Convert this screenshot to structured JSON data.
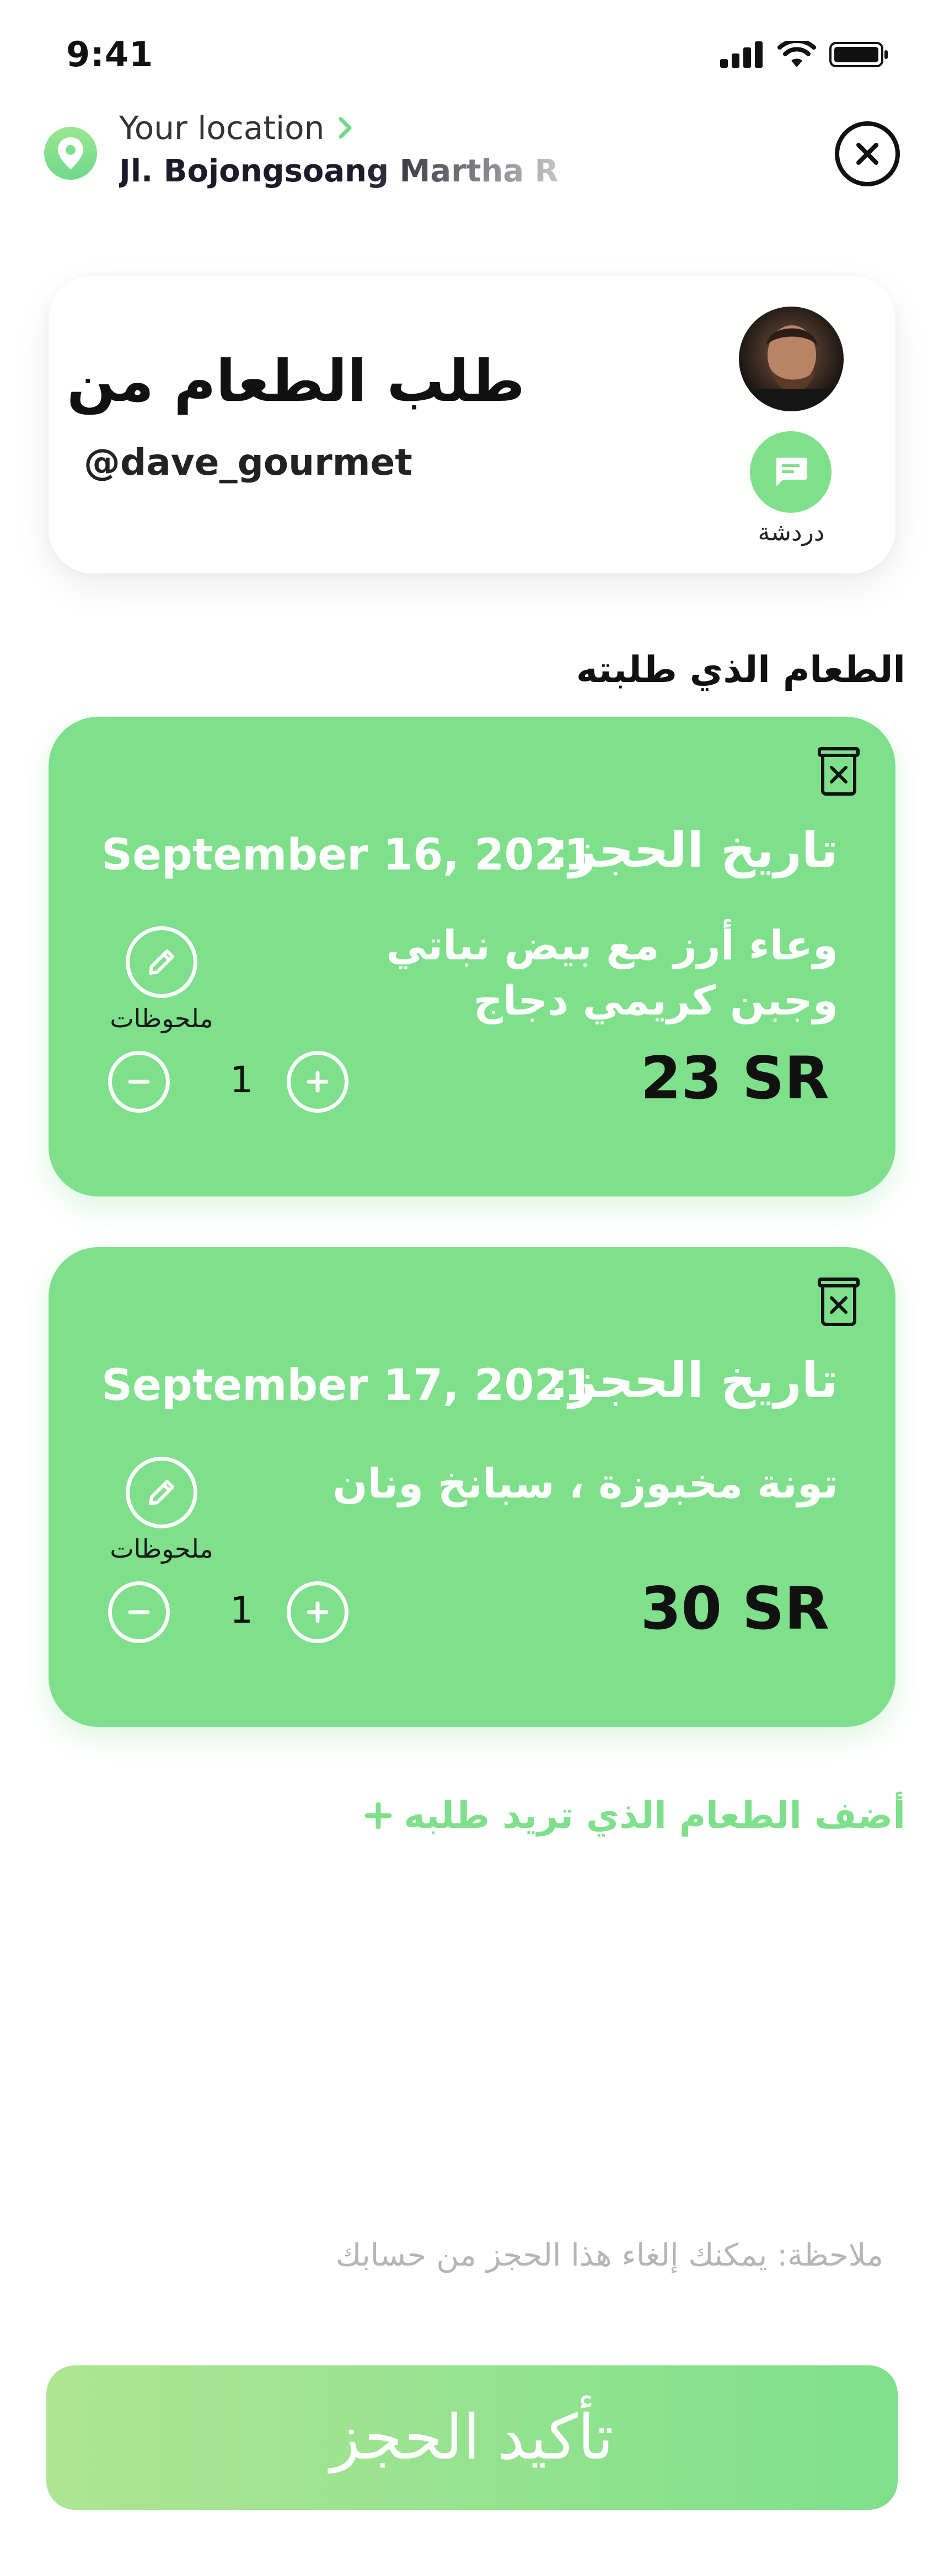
{
  "status_bar": {
    "time": "9:41"
  },
  "location": {
    "label": "Your location",
    "address": "Jl. Bojongsoang Martha Reg"
  },
  "chef": {
    "title": "طلب الطعام من",
    "handle": "@dave_gourmet",
    "chat_label": "دردشة"
  },
  "section_title": "الطعام الذي طلبته",
  "orders": [
    {
      "date_label": "تاريخ الحجز:",
      "date": "September 16, 2021",
      "dish": "وعاء أرز مع بيض نباتي وجبن كريمي دجاج",
      "notes_label": "ملحوظات",
      "quantity": "1",
      "price": "23 SR"
    },
    {
      "date_label": "تاريخ الحجز:",
      "date": "September 17, 2021",
      "dish": "تونة مخبوزة ، سبانخ ونان",
      "notes_label": "ملحوظات",
      "quantity": "1",
      "price": "30 SR"
    }
  ],
  "add_food_label": "أضف الطعام الذي تريد طلبه",
  "note": "ملاحظة: يمكنك إلغاء هذا الحجز من حسابك",
  "confirm_label": "تأكيد الحجز",
  "colors": {
    "accent": "#7ee08b",
    "accent_light": "#aee593"
  }
}
